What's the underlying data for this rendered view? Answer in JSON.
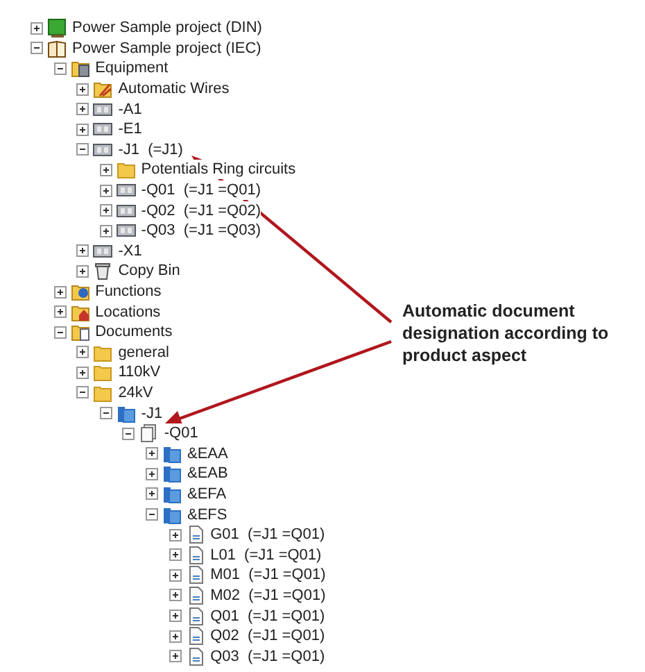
{
  "tree": {
    "nodes": [
      {
        "label": "Power Sample project (DIN)",
        "kind": "project",
        "expanded": false
      },
      {
        "label": "Power Sample project (IEC)",
        "kind": "book",
        "expanded": true,
        "children": [
          {
            "label": "Equipment",
            "kind": "equipment",
            "expanded": true,
            "children": [
              {
                "label": "Automatic Wires",
                "kind": "wires",
                "expanded": false
              },
              {
                "label": "-A1",
                "kind": "device",
                "expanded": false
              },
              {
                "label": "-E1",
                "kind": "device",
                "expanded": false
              },
              {
                "label": "-J1  (=J1)",
                "kind": "device",
                "expanded": true,
                "children": [
                  {
                    "label": "Potentials Ring circuits",
                    "kind": "folder",
                    "expanded": false
                  },
                  {
                    "label": "-Q01  (=J1 =Q01)",
                    "kind": "device",
                    "expanded": false
                  },
                  {
                    "label": "-Q02  (=J1 =Q02)",
                    "kind": "device",
                    "expanded": false
                  },
                  {
                    "label": "-Q03  (=J1 =Q03)",
                    "kind": "device",
                    "expanded": false
                  }
                ]
              },
              {
                "label": "-X1",
                "kind": "device",
                "expanded": false
              },
              {
                "label": "Copy Bin",
                "kind": "bin",
                "expanded": false
              }
            ]
          },
          {
            "label": "Functions",
            "kind": "functions",
            "expanded": false
          },
          {
            "label": "Locations",
            "kind": "locations",
            "expanded": false
          },
          {
            "label": "Documents",
            "kind": "documents",
            "expanded": true,
            "children": [
              {
                "label": "general",
                "kind": "folder",
                "expanded": false
              },
              {
                "label": "110kV",
                "kind": "folder",
                "expanded": false
              },
              {
                "label": "24kV",
                "kind": "folder",
                "expanded": true,
                "children": [
                  {
                    "label": "-J1",
                    "kind": "blue-folder",
                    "expanded": true,
                    "children": [
                      {
                        "label": "-Q01",
                        "kind": "doc-group",
                        "expanded": true,
                        "children": [
                          {
                            "label": "&EAA",
                            "kind": "blue-folder",
                            "expanded": false
                          },
                          {
                            "label": "&EAB",
                            "kind": "blue-folder",
                            "expanded": false
                          },
                          {
                            "label": "&EFA",
                            "kind": "blue-folder",
                            "expanded": false
                          },
                          {
                            "label": "&EFS",
                            "kind": "blue-folder",
                            "expanded": true,
                            "children": [
                              {
                                "label": "G01  (=J1 =Q01)",
                                "kind": "page",
                                "expanded": false
                              },
                              {
                                "label": "L01  (=J1 =Q01)",
                                "kind": "page",
                                "expanded": false
                              },
                              {
                                "label": "M01  (=J1 =Q01)",
                                "kind": "page",
                                "expanded": false
                              },
                              {
                                "label": "M02  (=J1 =Q01)",
                                "kind": "page",
                                "expanded": false
                              },
                              {
                                "label": "Q01  (=J1 =Q01)",
                                "kind": "page",
                                "expanded": false
                              },
                              {
                                "label": "Q02  (=J1 =Q01)",
                                "kind": "page",
                                "expanded": false
                              },
                              {
                                "label": "Q03  (=J1 =Q01)",
                                "kind": "page",
                                "expanded": false
                              }
                            ]
                          }
                        ]
                      }
                    ]
                  }
                ]
              }
            ]
          }
        ]
      }
    ]
  },
  "callout": {
    "text": "Automatic document designation according to product aspect"
  }
}
